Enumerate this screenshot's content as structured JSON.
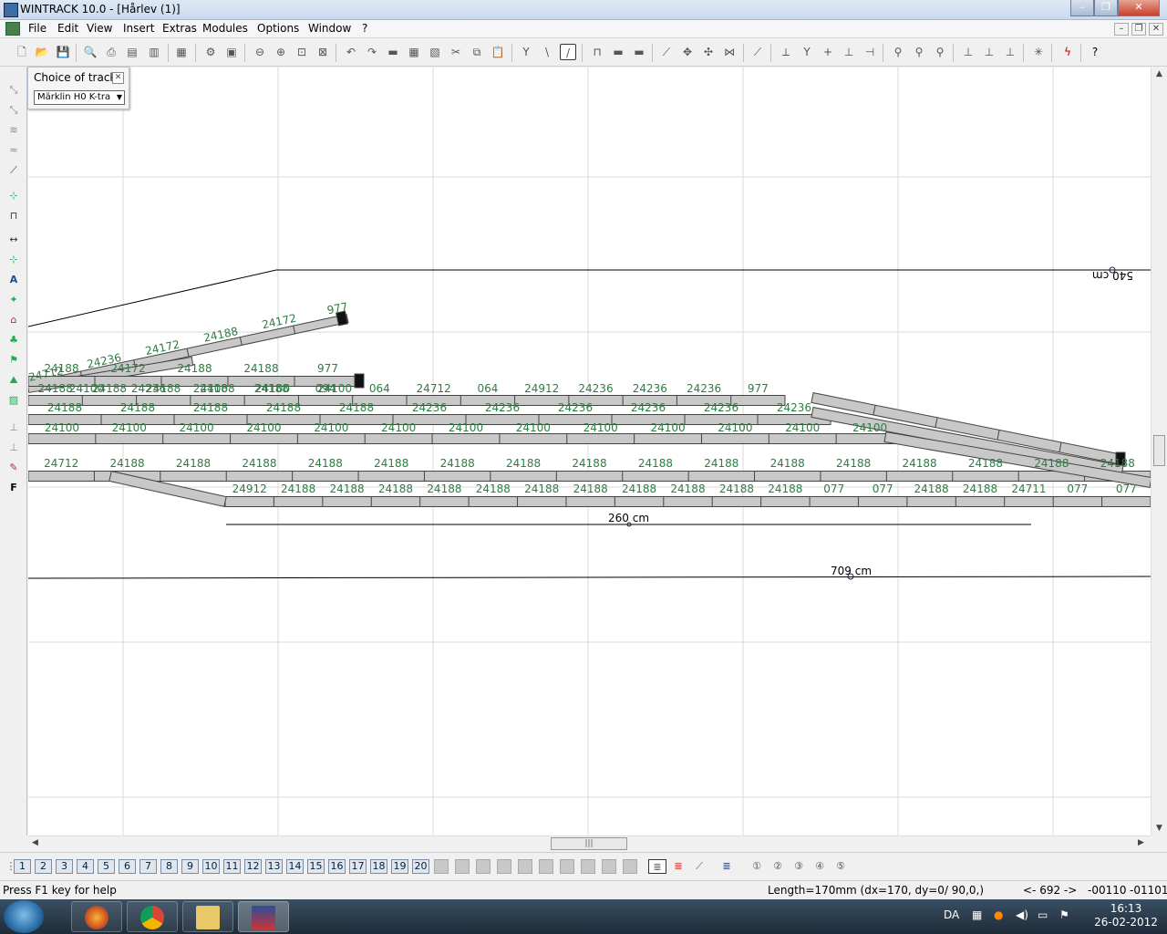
{
  "window": {
    "title": "WINTRACK 10.0 - [Hårlev (1)]"
  },
  "menu": [
    "File",
    "Edit",
    "View",
    "Insert",
    "Extras",
    "Modules",
    "Options",
    "Window",
    "?"
  ],
  "choice_panel": {
    "title": "Choice of track",
    "selected": "Märklin H0 K-tra"
  },
  "measurements": {
    "top": "540 cm",
    "middle": "260 cm",
    "bottom": "709 cm"
  },
  "track_labels": {
    "upper_branch": [
      "24712",
      "24236",
      "24172",
      "24188",
      "24172",
      "977"
    ],
    "row1": [
      "24188",
      "24172",
      "24188",
      "24188",
      "977"
    ],
    "row2": [
      "24188",
      "24188",
      "24188",
      "24188",
      "24188",
      "094",
      "064",
      "24712",
      "064",
      "24912",
      "24236",
      "24236",
      "24236",
      "977"
    ],
    "row3": [
      "24100",
      "24236",
      "24100",
      "24100",
      "24100"
    ],
    "row4": [
      "24188",
      "24188",
      "24188",
      "24188",
      "24188",
      "24236",
      "24236",
      "24236",
      "24236",
      "24236",
      "24236"
    ],
    "row5": [
      "24100",
      "24100",
      "24100",
      "24100",
      "24100",
      "24100",
      "24100",
      "24100",
      "24100",
      "24100",
      "24100",
      "24100",
      "24100"
    ],
    "row6": [
      "24712",
      "24188",
      "24188",
      "24188",
      "24188",
      "24188",
      "24188",
      "24188",
      "24188",
      "24188",
      "24188",
      "24188",
      "24188",
      "24188",
      "24188",
      "24188",
      "24188"
    ],
    "row7": [
      "24912",
      "24188",
      "24188",
      "24188",
      "24188",
      "24188",
      "24188",
      "24188",
      "24188",
      "24188",
      "24188",
      "24188",
      "077",
      "077",
      "24188",
      "24188",
      "24711",
      "077",
      "077"
    ]
  },
  "layers": [
    "1",
    "2",
    "3",
    "4",
    "5",
    "6",
    "7",
    "8",
    "9",
    "10",
    "11",
    "12",
    "13",
    "14",
    "15",
    "16",
    "17",
    "18",
    "19",
    "20"
  ],
  "status": {
    "help": "Press F1 key for help",
    "length": "Length=170mm (dx=170, dy=0/ 90,0,)",
    "zoom": "<- 692 ->",
    "x": "-00110",
    "y": "-01101"
  },
  "taskbar": {
    "lang": "DA",
    "time": "16:13",
    "date": "26-02-2012"
  }
}
